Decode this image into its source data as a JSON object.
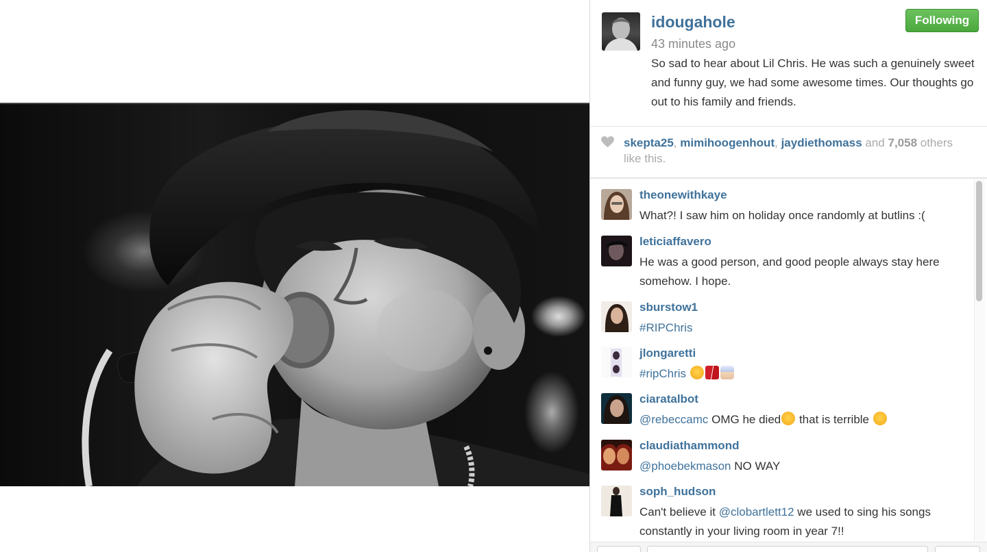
{
  "post": {
    "author": "idougahole",
    "timestamp": "43 minutes ago",
    "caption": "So sad to hear about Lil Chris. He was such a genuinely sweet and funny guy, we had some awesome times. Our thoughts go out to his family and friends.",
    "follow_label": "Following"
  },
  "likes": {
    "users": [
      "skepta25",
      "mimihoogenhout",
      "jaydiethomass"
    ],
    "sep1": ", ",
    "sep2": ", ",
    "and": " and ",
    "count": "7,058",
    "suffix": " others like this."
  },
  "comments": [
    {
      "user": "theonewithkaye",
      "text": "What?! I saw him on holiday once randomly at butlins :("
    },
    {
      "user": "leticiaffavero",
      "text": "He was a good person, and good people always stay here somehow. I hope."
    },
    {
      "user": "sburstow1",
      "tag": "#RIPChris"
    },
    {
      "user": "jlongaretti",
      "tag": "#ripChris"
    },
    {
      "user": "ciaratalbot",
      "mention": "@rebeccamc",
      "text1": " OMG he died",
      "text2": " that is terrible "
    },
    {
      "user": "claudiathammond",
      "mention": "@phoebekmason",
      "text": " NO WAY"
    },
    {
      "user": "soph_hudson",
      "text1": "Can't believe it ",
      "mention": "@clobartlett12",
      "text2": " we used to sing his songs constantly in your living room in year 7!!"
    }
  ],
  "colors": {
    "username_blue": "#3f729b",
    "follow_green": "#4aa83e",
    "muted_gray": "#8a8a8a"
  },
  "icons": {
    "heart": "heart-icon",
    "emoji_crying": "crying-face-emoji",
    "emoji_broken_heart": "broken-heart-emoji",
    "emoji_angel": "angel-emoji",
    "emoji_hushed": "hushed-face-emoji"
  }
}
